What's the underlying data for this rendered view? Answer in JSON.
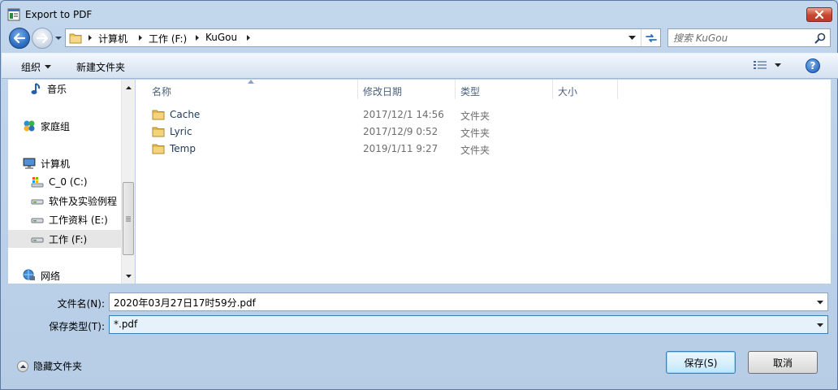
{
  "window": {
    "title": "Export to PDF"
  },
  "address": {
    "breadcrumbs": [
      "计算机",
      "工作 (F:)",
      "KuGou"
    ],
    "search_placeholder": "搜索 KuGou"
  },
  "toolbar": {
    "organize_label": "组织",
    "new_folder_label": "新建文件夹"
  },
  "navpane": {
    "items": [
      {
        "label": "音乐",
        "icon": "music-icon",
        "level": 1
      },
      {
        "label": "家庭组",
        "icon": "homegroup-icon",
        "level": 0
      },
      {
        "label": "计算机",
        "icon": "computer-icon",
        "level": 0
      },
      {
        "label": "C_0 (C:)",
        "icon": "system-drive-icon",
        "level": 1
      },
      {
        "label": "软件及实验例程",
        "icon": "drive-icon",
        "level": 1
      },
      {
        "label": "工作资料 (E:)",
        "icon": "drive-icon",
        "level": 1
      },
      {
        "label": "工作 (F:)",
        "icon": "drive-icon",
        "level": 1,
        "selected": true
      },
      {
        "label": "网络",
        "icon": "network-icon",
        "level": 0
      }
    ]
  },
  "filelist": {
    "columns": [
      "名称",
      "修改日期",
      "类型",
      "大小"
    ],
    "rows": [
      {
        "name": "Cache",
        "date": "2017/12/1 14:56",
        "type": "文件夹",
        "size": ""
      },
      {
        "name": "Lyric",
        "date": "2017/12/9 0:52",
        "type": "文件夹",
        "size": ""
      },
      {
        "name": "Temp",
        "date": "2019/1/11 9:27",
        "type": "文件夹",
        "size": ""
      }
    ]
  },
  "form": {
    "filename_label": "文件名(N):",
    "filename_value": "2020年03月27日17时59分.pdf",
    "filetype_label": "保存类型(T):",
    "filetype_value": "*.pdf"
  },
  "footer": {
    "hide_folders_label": "隐藏文件夹",
    "save_label": "保存(S)",
    "cancel_label": "取消"
  },
  "colors": {
    "accent": "#3c7fb1",
    "window_frame": "#b9d1ea",
    "column_header_text": "#4c607a",
    "file_name_text": "#1e395b",
    "secondary_text": "#6d6d6d"
  }
}
